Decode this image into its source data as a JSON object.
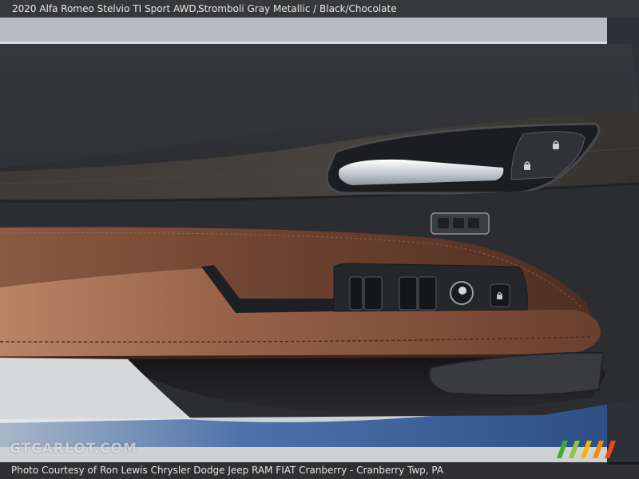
{
  "caption": {
    "vehicle": "2020 Alfa Romeo Stelvio TI Sport AWD,",
    "colors": "Stromboli Gray Metallic / Black/Chocolate"
  },
  "watermark": {
    "text": "GTCARLOT.COM",
    "logo_icon": "striped-flag-logo"
  },
  "footer": {
    "credit": "Photo Courtesy of Ron Lewis Chrysler Dodge Jeep RAM FIAT Cranberry - Cranberry Twp, PA"
  },
  "colors": {
    "leather_chocolate": "#7a4a33",
    "panel_black": "#2b2c2f",
    "wood_trim": "#3a3734",
    "chrome": "#d9dde2",
    "exterior_blue": "#3a5f99",
    "logo_stripes": [
      "#3fae2a",
      "#8cc63f",
      "#f7b500",
      "#f28c00",
      "#e64b1d"
    ]
  }
}
